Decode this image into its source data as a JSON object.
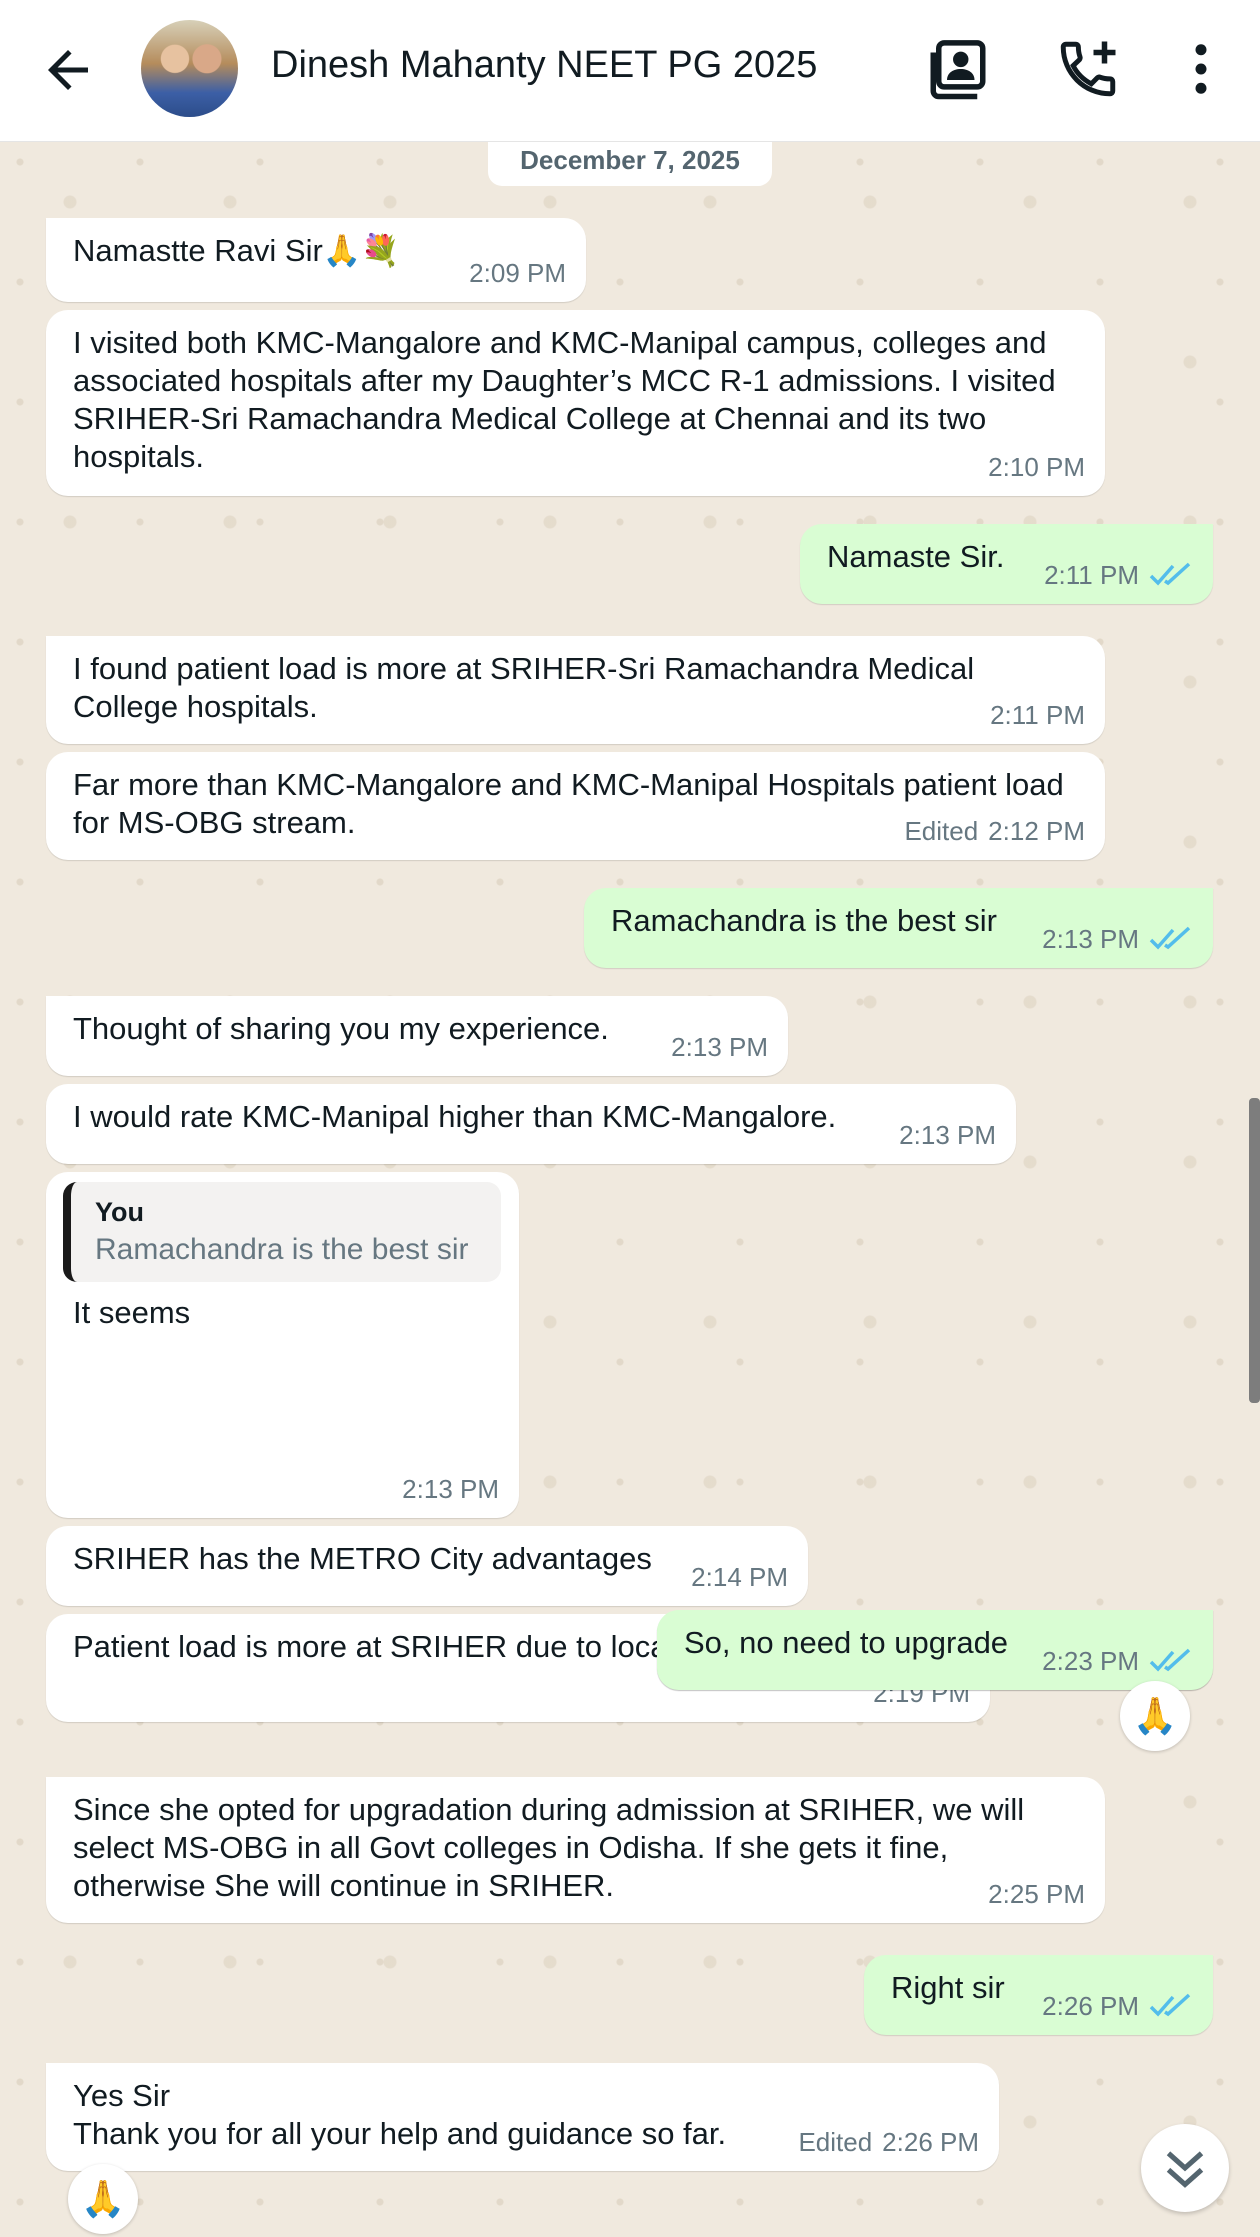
{
  "header": {
    "title": "Dinesh Mahanty NEET PG 2025",
    "icons": [
      "back-arrow-icon",
      "avatar",
      "contact-card-icon",
      "add-call-icon",
      "more-vertical-icon"
    ]
  },
  "date": "December 7, 2025",
  "messages": [
    {
      "dir": "in",
      "text": "Namastte Ravi Sir🙏💐",
      "time": "2:09 PM"
    },
    {
      "dir": "in",
      "text": "I visited both KMC-Mangalore and KMC-Manipal campus, colleges and associated hospitals after my Daughter’s MCC R-1 admissions. I visited SRIHER-Sri Ramachandra Medical College at Chennai and its two hospitals.",
      "time": "2:10 PM"
    },
    {
      "dir": "out",
      "text": "Namaste Sir.",
      "time": "2:11 PM"
    },
    {
      "dir": "in",
      "text": "I found patient load is more at SRIHER-Sri Ramachandra Medical College hospitals.",
      "time": "2:11 PM"
    },
    {
      "dir": "in",
      "text": "Far more than KMC-Mangalore and KMC-Manipal Hospitals patient load for MS-OBG stream.",
      "time": "2:12 PM",
      "edited": "Edited"
    },
    {
      "dir": "out",
      "text": "Ramachandra is the best sir",
      "time": "2:13 PM"
    },
    {
      "dir": "in",
      "text": "Thought of sharing you my experience.",
      "time": "2:13 PM"
    },
    {
      "dir": "in",
      "text": "I would rate KMC-Manipal higher than KMC-Mangalore.",
      "time": "2:13 PM"
    },
    {
      "dir": "in",
      "text": "It seems",
      "time": "2:13 PM",
      "quote_author": "You",
      "quote_text": "Ramachandra is the best sir"
    },
    {
      "dir": "in",
      "text": "SRIHER has the METRO City advantages",
      "time": "2:14 PM"
    },
    {
      "dir": "in",
      "text": "Patient load is more at SRIHER due to location in a METRO City",
      "time": "2:19 PM"
    },
    {
      "dir": "out",
      "text": "So, no need to upgrade",
      "time": "2:23 PM",
      "reaction": "🙏"
    },
    {
      "dir": "in",
      "text": "Since she opted for upgradation during admission at SRIHER, we will select MS-OBG in all Govt colleges in Odisha. If she gets it fine, otherwise She will continue in SRIHER.",
      "time": "2:25 PM"
    },
    {
      "dir": "out",
      "text": "Right sir",
      "time": "2:26 PM"
    },
    {
      "dir": "in",
      "text_line1": "Yes Sir",
      "text_line2": "Thank you for all your help and guidance so far.",
      "time": "2:26 PM",
      "edited": "Edited",
      "reaction": "🙏"
    }
  ],
  "colors": {
    "incoming": "#ffffff",
    "outgoing": "#d9fdd3",
    "read_ticks": "#53bdeb",
    "wallpaper": "#f0e9de"
  }
}
